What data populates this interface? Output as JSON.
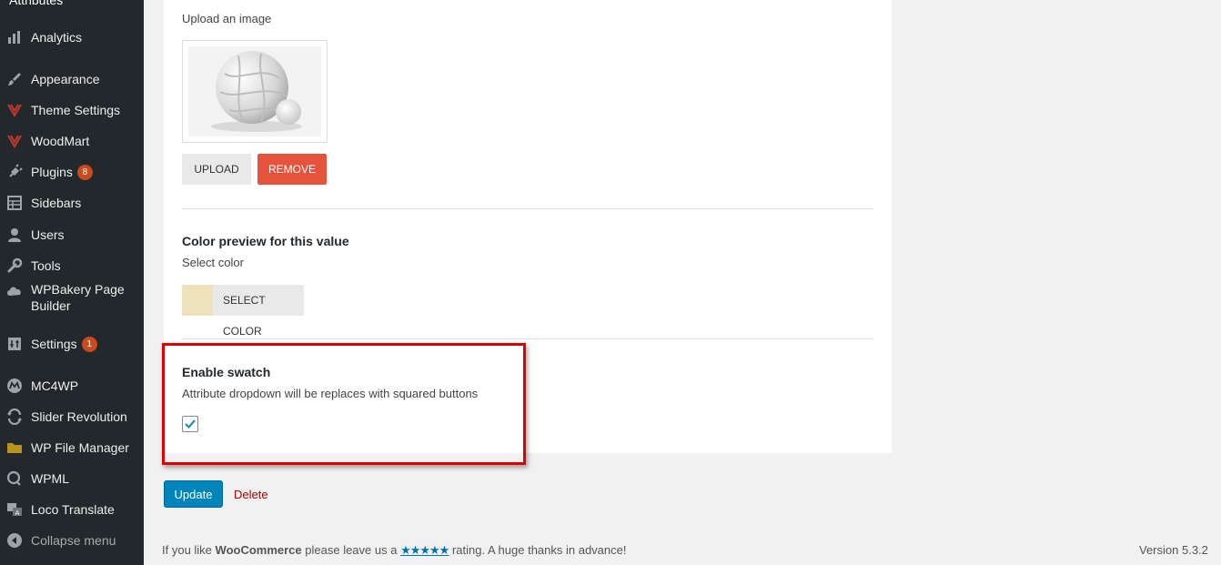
{
  "sidebar": {
    "top_cut_label": "Attributes",
    "items": [
      {
        "label": "Analytics",
        "icon": "bar-chart-icon"
      },
      {
        "label": "Appearance",
        "icon": "paintbrush-icon"
      },
      {
        "label": "Theme Settings",
        "icon": "woodmart-icon"
      },
      {
        "label": "WoodMart",
        "icon": "woodmart-icon"
      },
      {
        "label": "Plugins",
        "icon": "plug-icon",
        "badge": "8"
      },
      {
        "label": "Sidebars",
        "icon": "table-icon"
      },
      {
        "label": "Users",
        "icon": "user-icon"
      },
      {
        "label": "Tools",
        "icon": "wrench-icon"
      },
      {
        "label": "WPBakery Page Builder",
        "icon": "cloud-icon"
      },
      {
        "label": "Settings",
        "icon": "settings-icon",
        "badge": "1"
      },
      {
        "label": "MC4WP",
        "icon": "mc4wp-icon"
      },
      {
        "label": "Slider Revolution",
        "icon": "refresh-icon"
      },
      {
        "label": "WP File Manager",
        "icon": "folder-icon"
      },
      {
        "label": "WPML",
        "icon": "wpml-icon"
      },
      {
        "label": "Loco Translate",
        "icon": "translate-icon"
      },
      {
        "label": "Collapse menu",
        "icon": "collapse-icon"
      }
    ]
  },
  "image_section": {
    "subtitle": "Upload an image",
    "upload_label": "UPLOAD",
    "remove_label": "REMOVE"
  },
  "color_section": {
    "title": "Color preview for this value",
    "subtitle": "Select color",
    "button_label": "SELECT COLOR",
    "swatch_color": "#eee2bc"
  },
  "swatch_section": {
    "title": "Enable swatch",
    "description": "Attribute dropdown will be replaces with squared buttons",
    "checked": true
  },
  "actions": {
    "update_label": "Update",
    "delete_label": "Delete"
  },
  "footer": {
    "prefix": "If you like ",
    "brand": "WooCommerce",
    "middle": " please leave us a ",
    "stars": "★★★★★",
    "suffix": " rating. A huge thanks in advance!",
    "version": "Version 5.3.2"
  },
  "colors": {
    "sidebar_bg": "#23282d",
    "remove_red": "#e6533c",
    "update_blue": "#0085ba",
    "highlight_red": "#dd0000",
    "badge": "#ca4a1f"
  }
}
